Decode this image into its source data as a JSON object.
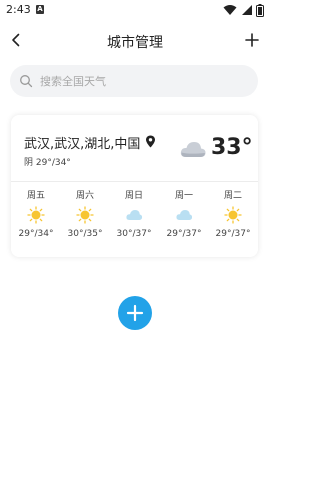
{
  "status_bar": {
    "time": "2:43",
    "notification_letter": "A"
  },
  "header": {
    "title": "城市管理"
  },
  "search": {
    "placeholder": "搜索全国天气"
  },
  "city_card": {
    "location": "武汉,武汉,湖北,中国",
    "summary": "阴 29°/34°",
    "current_temp": "33°",
    "current_icon": "cloud-icon",
    "forecast": [
      {
        "day": "周五",
        "icon": "sun-icon",
        "temp": "29°/34°"
      },
      {
        "day": "周六",
        "icon": "sun-icon",
        "temp": "30°/35°"
      },
      {
        "day": "周日",
        "icon": "cloud-icon",
        "temp": "30°/37°"
      },
      {
        "day": "周一",
        "icon": "cloud-icon",
        "temp": "29°/37°"
      },
      {
        "day": "周二",
        "icon": "sun-icon",
        "temp": "29°/37°"
      }
    ]
  },
  "colors": {
    "accent": "#22a2e8",
    "sun": "#f7c531",
    "cloud": "#b9dff2"
  }
}
